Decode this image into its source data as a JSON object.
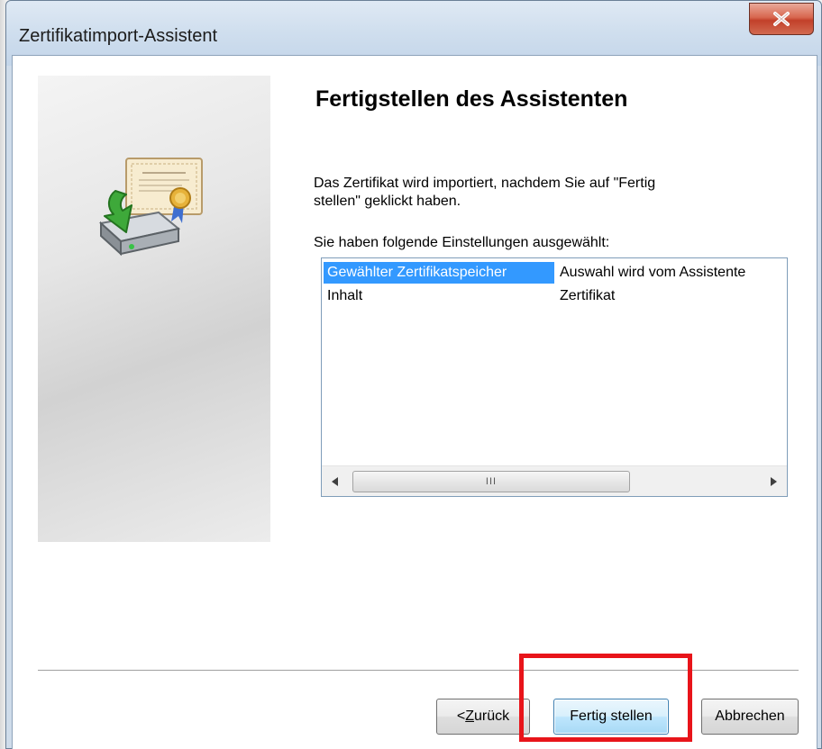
{
  "window": {
    "title": "Zertifikatimport-Assistent"
  },
  "page": {
    "heading": "Fertigstellen des Assistenten",
    "intro_line1": "Das Zertifikat wird importiert, nachdem Sie auf \"Fertig",
    "intro_line2": "stellen\" geklickt haben.",
    "settings_label": "Sie haben folgende Einstellungen ausgewählt:"
  },
  "settings_list": {
    "rows": [
      {
        "name": "Gewählter Zertifikatspeicher",
        "value": "Auswahl wird vom Assistente",
        "selected": true
      },
      {
        "name": "Inhalt",
        "value": "Zertifikat",
        "selected": false
      }
    ],
    "scroll_thumb_grip": "III"
  },
  "buttons": {
    "back_prefix": "< ",
    "back_underlined": "Z",
    "back_rest": "urück",
    "finish": "Fertig stellen",
    "cancel": "Abbrechen"
  },
  "icons": {
    "close": "close-icon",
    "wizard": "certificate-import-icon",
    "scroll_left": "scroll-left-arrow-icon",
    "scroll_right": "scroll-right-arrow-icon"
  },
  "colors": {
    "selection": "#3399ff",
    "highlight_annotation": "#e8141a",
    "close_button": "#c2402a"
  }
}
